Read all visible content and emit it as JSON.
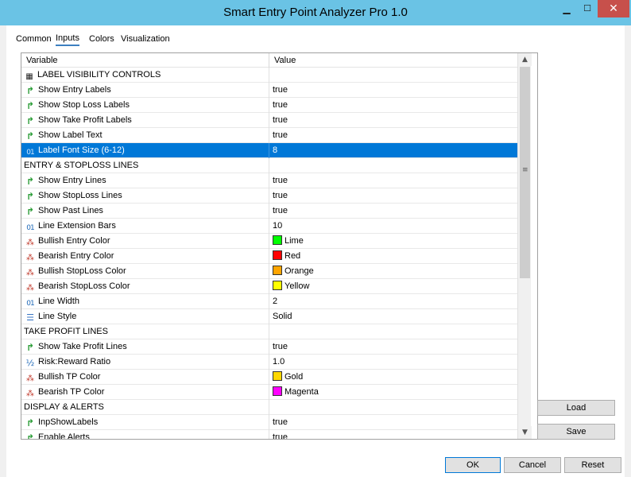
{
  "window": {
    "title": "Smart Entry Point Analyzer Pro 1.0",
    "minimize_glyph": "▁",
    "maximize_glyph": "☐",
    "close_glyph": "✕"
  },
  "tabs": [
    {
      "label": "Common",
      "active": false
    },
    {
      "label": "Inputs",
      "active": true
    },
    {
      "label": "Colors",
      "active": false
    },
    {
      "label": "Visualization",
      "active": false
    }
  ],
  "grid": {
    "columns": {
      "variable": "Variable",
      "value": "Value"
    },
    "rows": [
      {
        "type": "section",
        "icon": "section-icon",
        "variable": "LABEL VISIBILITY CONTROLS",
        "value": ""
      },
      {
        "type": "bool",
        "icon": "bool-arrow-icon",
        "variable": "Show Entry Labels",
        "value": "true"
      },
      {
        "type": "bool",
        "icon": "bool-arrow-icon",
        "variable": "Show Stop Loss Labels",
        "value": "true"
      },
      {
        "type": "bool",
        "icon": "bool-arrow-icon",
        "variable": "Show Take Profit Labels",
        "value": "true"
      },
      {
        "type": "bool",
        "icon": "bool-arrow-icon",
        "variable": "Show Label Text",
        "value": "true"
      },
      {
        "type": "num",
        "icon": "integer-icon",
        "variable": "Label Font Size (6-12)",
        "value": "8",
        "selected": true
      },
      {
        "type": "section",
        "icon": "",
        "variable": "ENTRY & STOPLOSS LINES",
        "value": ""
      },
      {
        "type": "bool",
        "icon": "bool-arrow-icon",
        "variable": "Show Entry Lines",
        "value": "true"
      },
      {
        "type": "bool",
        "icon": "bool-arrow-icon",
        "variable": "Show StopLoss Lines",
        "value": "true"
      },
      {
        "type": "bool",
        "icon": "bool-arrow-icon",
        "variable": "Show Past Lines",
        "value": "true"
      },
      {
        "type": "num",
        "icon": "integer-icon",
        "variable": "Line Extension Bars",
        "value": "10"
      },
      {
        "type": "color",
        "icon": "color-icon",
        "variable": "Bullish Entry Color",
        "value": "Lime",
        "swatch": "#00ff00"
      },
      {
        "type": "color",
        "icon": "color-icon",
        "variable": "Bearish Entry Color",
        "value": "Red",
        "swatch": "#ff0000"
      },
      {
        "type": "color",
        "icon": "color-icon",
        "variable": "Bullish StopLoss Color",
        "value": "Orange",
        "swatch": "#ffa500"
      },
      {
        "type": "color",
        "icon": "color-icon",
        "variable": "Bearish StopLoss Color",
        "value": "Yellow",
        "swatch": "#ffff00"
      },
      {
        "type": "num",
        "icon": "integer-icon",
        "variable": "Line Width",
        "value": "2"
      },
      {
        "type": "style",
        "icon": "line-style-icon",
        "variable": "Line Style",
        "value": "Solid"
      },
      {
        "type": "section",
        "icon": "",
        "variable": "TAKE PROFIT LINES",
        "value": ""
      },
      {
        "type": "bool",
        "icon": "bool-arrow-icon",
        "variable": "Show Take Profit Lines",
        "value": "true"
      },
      {
        "type": "frac",
        "icon": "fraction-icon",
        "variable": "Risk:Reward Ratio",
        "value": "1.0"
      },
      {
        "type": "color",
        "icon": "color-icon",
        "variable": "Bullish TP Color",
        "value": "Gold",
        "swatch": "#ffd700"
      },
      {
        "type": "color",
        "icon": "color-icon",
        "variable": "Bearish TP Color",
        "value": "Magenta",
        "swatch": "#ff00ff"
      },
      {
        "type": "section",
        "icon": "",
        "variable": "DISPLAY & ALERTS",
        "value": ""
      },
      {
        "type": "bool",
        "icon": "bool-arrow-icon",
        "variable": "InpShowLabels",
        "value": "true"
      },
      {
        "type": "bool",
        "icon": "bool-arrow-icon",
        "variable": "Enable Alerts",
        "value": "true"
      }
    ]
  },
  "buttons": {
    "load": "Load",
    "save": "Save",
    "ok": "OK",
    "cancel": "Cancel",
    "reset": "Reset"
  },
  "colors": {
    "titlebar": "#6ac3e5",
    "selection": "#0078d7",
    "close": "#c7504b"
  }
}
